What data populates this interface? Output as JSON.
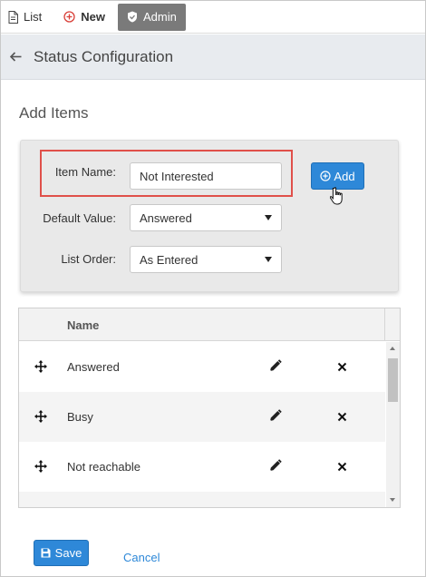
{
  "nav": {
    "list_label": "List",
    "new_label": "New",
    "admin_label": "Admin"
  },
  "header": {
    "title": "Status Configuration"
  },
  "section": {
    "title": "Add Items"
  },
  "form": {
    "item_name_label": "Item Name:",
    "item_name_value": "Not Interested",
    "default_value_label": "Default Value:",
    "default_value_selected": "Answered",
    "list_order_label": "List Order:",
    "list_order_selected": "As Entered",
    "add_button_label": "Add"
  },
  "table": {
    "header_name": "Name",
    "rows": [
      {
        "name": "Answered"
      },
      {
        "name": "Busy"
      },
      {
        "name": "Not reachable"
      }
    ]
  },
  "footer": {
    "save_label": "Save",
    "cancel_label": "Cancel"
  },
  "colors": {
    "accent": "#2e88d8",
    "highlight": "#e0504a",
    "header_bg": "#e8ebef",
    "admin_bg": "#7a7a7a"
  },
  "icons": [
    "document-icon",
    "plus-circle-icon",
    "shield-icon",
    "back-arrow-icon",
    "move-icon",
    "pencil-icon",
    "close-icon",
    "save-icon",
    "hand-cursor-icon"
  ]
}
